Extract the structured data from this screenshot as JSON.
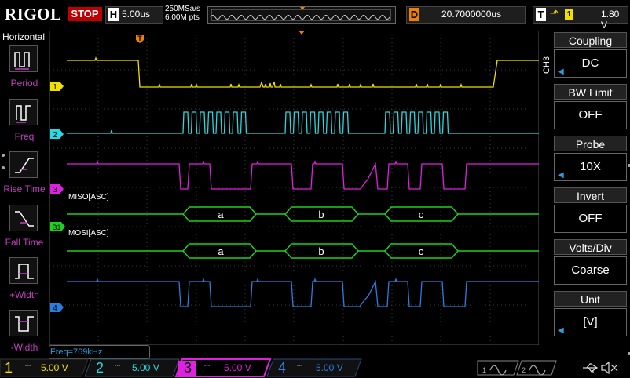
{
  "brand": {
    "logo": "RIGOL",
    "run_state": "STOP"
  },
  "timebase": {
    "label": "H",
    "value": "5.00us",
    "sample_rate": "250MSa/s",
    "memory_depth": "6.00M pts"
  },
  "delay": {
    "label": "D",
    "value": "20.7000000us"
  },
  "trigger": {
    "label": "T",
    "edge_symbol": "⬏",
    "channel": "1",
    "level": "1.80 V"
  },
  "left_menu": {
    "title": "Horizontal",
    "items": [
      {
        "label": "Period",
        "icon": "period-icon"
      },
      {
        "label": "Freq",
        "icon": "freq-icon"
      },
      {
        "label": "Rise Time",
        "icon": "rise-time-icon"
      },
      {
        "label": "Fall Time",
        "icon": "fall-time-icon"
      },
      {
        "label": "+Width",
        "icon": "pos-width-icon"
      },
      {
        "label": "-Width",
        "icon": "neg-width-icon"
      }
    ]
  },
  "right_menu": {
    "channel_tag": "CH3",
    "items": [
      {
        "title": "Coupling",
        "value": "DC",
        "has_arrow": true
      },
      {
        "title": "BW Limit",
        "value": "OFF",
        "has_arrow": false
      },
      {
        "title": "Probe",
        "value": "10X",
        "has_arrow": true
      },
      {
        "title": "Invert",
        "value": "OFF",
        "has_arrow": false
      },
      {
        "title": "Volts/Div",
        "value": "Coarse",
        "has_arrow": false
      },
      {
        "title": "Unit",
        "value": "[V]",
        "has_arrow": true
      }
    ]
  },
  "traces": {
    "ch1_marker": "1",
    "ch2_marker": "2",
    "ch3_marker": "3",
    "b1_marker": "B1",
    "ch4_marker": "4",
    "miso_label": "MISO[ASC]",
    "mosi_label": "MOSI[ASC]",
    "miso_bytes": [
      "a",
      "b",
      "c"
    ],
    "mosi_bytes": [
      "a",
      "b",
      "c"
    ],
    "trigger_marker": "T"
  },
  "measurement": {
    "freq": "Freq=769kHz"
  },
  "bottom": {
    "channels": [
      {
        "num": "1",
        "scale": "5.00 V",
        "color": "#f0e000"
      },
      {
        "num": "2",
        "scale": "5.00 V",
        "color": "#2ad8e0"
      },
      {
        "num": "3",
        "scale": "5.00 V",
        "color": "#e020e0"
      },
      {
        "num": "4",
        "scale": "5.00 V",
        "color": "#2a7de0"
      }
    ]
  },
  "colors": {
    "ch1": "#f0e000",
    "ch2": "#2ad8e0",
    "ch3": "#e020e0",
    "ch4": "#2a7de0",
    "bus": "#20d020",
    "delay": "#f08000"
  }
}
